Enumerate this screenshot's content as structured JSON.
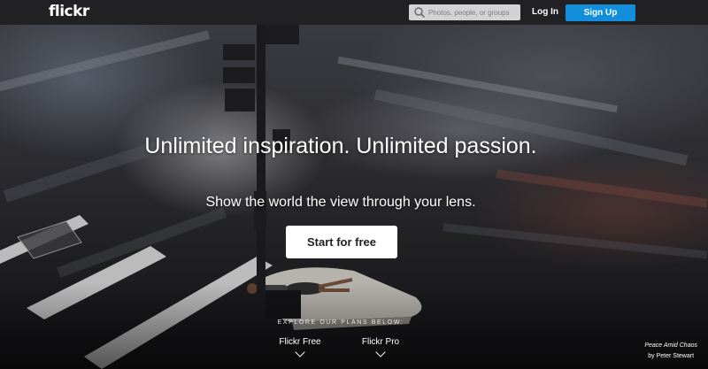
{
  "header": {
    "logo_text": "flickr",
    "search_placeholder": "Photos, people, or groups",
    "login_label": "Log In",
    "signup_label": "Sign Up",
    "signup_color": "#128fdc",
    "bar_color": "#212124"
  },
  "hero": {
    "headline": "Unlimited inspiration. Unlimited passion.",
    "subheadline": "Show the world the view through your lens.",
    "cta_label": "Start for free",
    "plans_heading": "EXPLORE OUR PLANS BELOW:",
    "plans": [
      {
        "label": "Flickr Free",
        "icon": "chevron-down-icon"
      },
      {
        "label": "Flickr Pro",
        "icon": "chevron-down-icon"
      }
    ]
  },
  "photo_credit": {
    "title": "Peace Amid Chaos",
    "author": "by Peter Stewart"
  },
  "icons": {
    "search": "search-icon"
  }
}
